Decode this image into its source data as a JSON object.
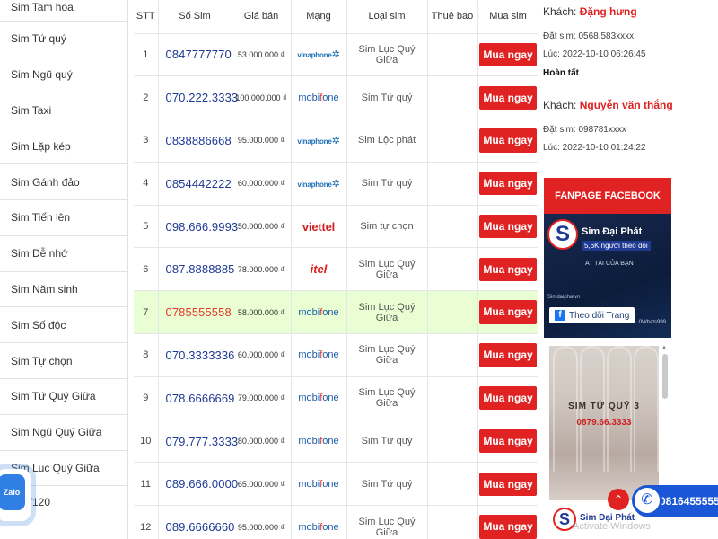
{
  "sidebar": {
    "items": [
      {
        "label": "Sim Tam hoa"
      },
      {
        "label": "Sim Tứ quý"
      },
      {
        "label": "Sim Ngũ quý"
      },
      {
        "label": "Sim Taxi"
      },
      {
        "label": "Sim Lặp kép"
      },
      {
        "label": "Sim Gánh đảo"
      },
      {
        "label": "Sim Tiến lên"
      },
      {
        "label": "Sim Dễ nhớ"
      },
      {
        "label": "Sim Năm sinh"
      },
      {
        "label": "Sim Số độc"
      },
      {
        "label": "Sim Tự chọn"
      },
      {
        "label": "Sim Tứ Quý Giữa"
      },
      {
        "label": "Sim Ngũ Quý Giữa"
      },
      {
        "label": "Sim Lục Quý Giữa"
      }
    ],
    "partial_item": "V120"
  },
  "table": {
    "headers": [
      "STT",
      "Số Sim",
      "Giá bán",
      "Mạng",
      "Loại sim",
      "Thuê bao",
      "Mua sim"
    ],
    "buy_label": "Mua ngay",
    "rows": [
      {
        "stt": "1",
        "phone": "0847777770",
        "price": "53.000.000 ₫",
        "network": "vinaphone",
        "category": "Sim Lục Quý Giữa"
      },
      {
        "stt": "2",
        "phone": "070.222.3333",
        "price": "100.000.000 ₫",
        "network": "mobifone",
        "category": "Sim Tứ quý"
      },
      {
        "stt": "3",
        "phone": "0838886668",
        "price": "95.000.000 ₫",
        "network": "vinaphone",
        "category": "Sim Lộc phát"
      },
      {
        "stt": "4",
        "phone": "0854442222",
        "price": "60.000.000 ₫",
        "network": "vinaphone",
        "category": "Sim Tứ quý"
      },
      {
        "stt": "5",
        "phone": "098.666.9993",
        "price": "50.000.000 ₫",
        "network": "viettel",
        "category": "Sim tự chọn"
      },
      {
        "stt": "6",
        "phone": "087.8888885",
        "price": "78.000.000 ₫",
        "network": "itel",
        "category": "Sim Lục Quý Giữa"
      },
      {
        "stt": "7",
        "phone": "0785555558",
        "price": "58.000.000 ₫",
        "network": "mobifone",
        "category": "Sim Lục Quý Giữa",
        "highlight": true
      },
      {
        "stt": "8",
        "phone": "070.3333336",
        "price": "60.000.000 ₫",
        "network": "mobifone",
        "category": "Sim Lục Quý Giữa"
      },
      {
        "stt": "9",
        "phone": "078.6666669",
        "price": "79.000.000 ₫",
        "network": "mobifone",
        "category": "Sim Lục Quý Giữa"
      },
      {
        "stt": "10",
        "phone": "079.777.3333",
        "price": "80.000.000 ₫",
        "network": "mobifone",
        "category": "Sim Tứ quý"
      },
      {
        "stt": "11",
        "phone": "089.666.0000",
        "price": "65.000.000 ₫",
        "network": "mobifone",
        "category": "Sim Tứ quý"
      },
      {
        "stt": "12",
        "phone": "089.6666660",
        "price": "95.000.000 ₫",
        "network": "mobifone",
        "category": "Sim Lục Quý Giữa"
      }
    ]
  },
  "network_labels": {
    "vinaphone": "vinaphone",
    "mobifone_a": "mobi",
    "mobifone_b": "f",
    "mobifone_c": "one",
    "viettel": "viettel",
    "itel": "itel"
  },
  "orders": [
    {
      "prefix": "Khách:",
      "customer": "Đặng hưng",
      "sim_line": "Đặt sim: 0568.583xxxx",
      "time_line": "Lúc: 2022-10-10 06:26:45",
      "status": "Hoàn tất"
    },
    {
      "prefix": "Khách:",
      "customer": "Nguyễn văn thắng",
      "sim_line": "Đặt sim: 098781xxxx",
      "time_line": "Lúc: 2022-10-10 01:24:22"
    }
  ],
  "fanpage": {
    "title": "FANPAGE FACEBOOK",
    "page_name": "Sim Đại Phát",
    "followers": "5,6K người theo dõi",
    "tagline": "AT TÀI CỦA BẠN",
    "small_text": "Simdaiphatvn",
    "number": "0Whats999",
    "follow_label": "Theo dõi Trang"
  },
  "banner": {
    "title": "SIM TỨ QUÝ 3",
    "number": "0879.66.3333",
    "footer_name": "Sim Đại Phát"
  },
  "contact": {
    "zalo_label": "Zalo",
    "phone": "0816455555"
  },
  "watermark": "Activate Windows",
  "colors": {
    "accent_red": "#e02222",
    "phone_blue": "#1f3a93",
    "highlight_row": "#e9ffd3"
  }
}
